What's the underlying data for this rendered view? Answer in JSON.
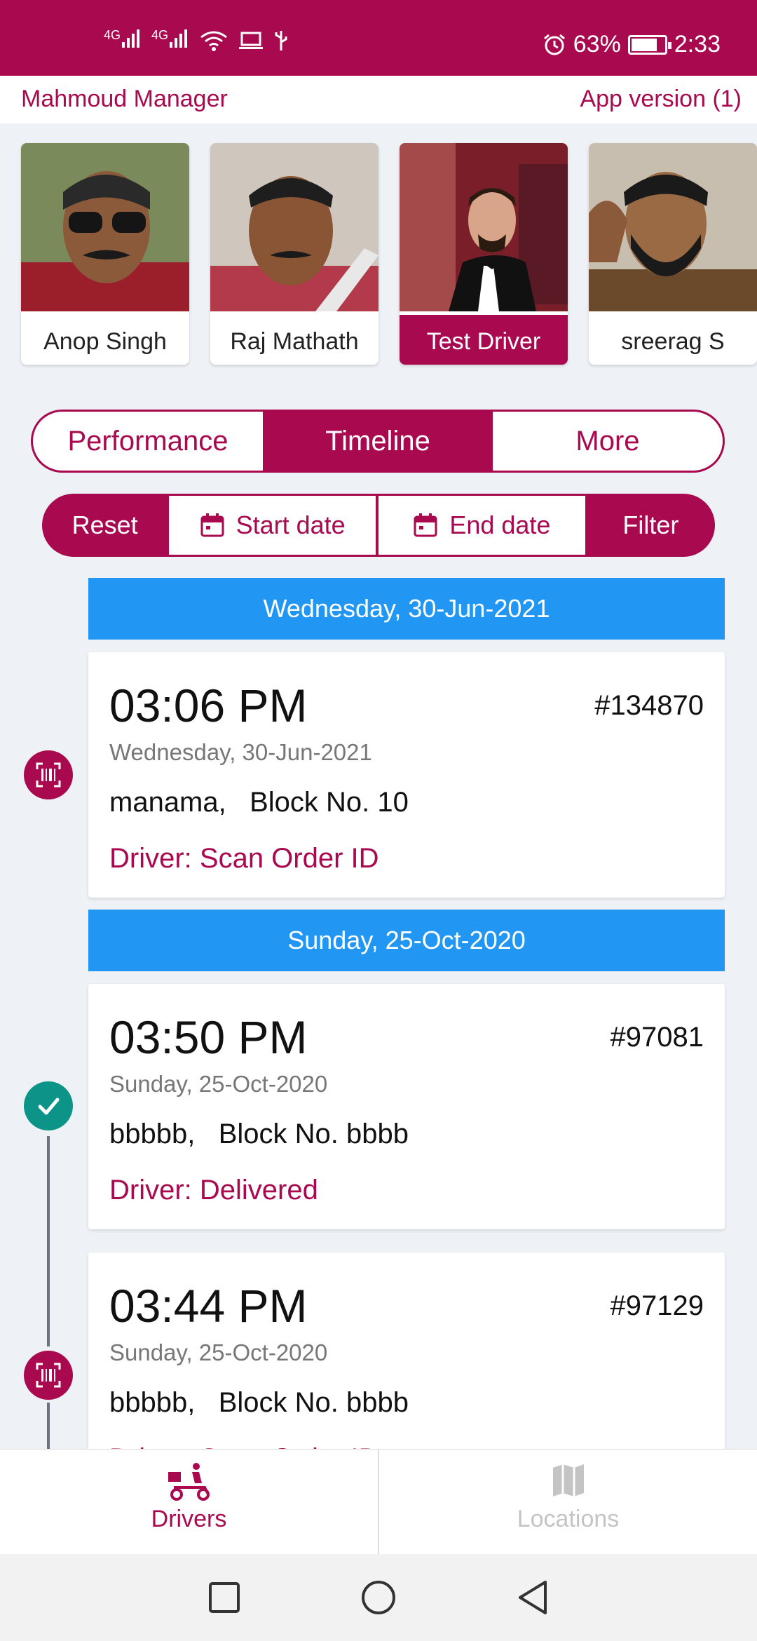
{
  "status_bar": {
    "signal1": "4G",
    "signal2": "4G",
    "battery": "63%",
    "time": "2:33"
  },
  "header": {
    "manager": "Mahmoud Manager",
    "version": "App version (1)"
  },
  "drivers": [
    {
      "name": "Anop Singh",
      "active": false
    },
    {
      "name": "Raj Mathath",
      "active": false
    },
    {
      "name": "Test Driver",
      "active": true
    },
    {
      "name": "sreerag S",
      "active": false
    }
  ],
  "tabs": {
    "performance": "Performance",
    "timeline": "Timeline",
    "more": "More",
    "selected": "Timeline"
  },
  "filters": {
    "reset": "Reset",
    "start_date": "Start date",
    "end_date": "End date",
    "filter": "Filter"
  },
  "timeline": {
    "groups": [
      {
        "date_header": "Wednesday, 30-Jun-2021"
      },
      {
        "date_header": "Sunday, 25-Oct-2020"
      }
    ],
    "entries": [
      {
        "time": "03:06 PM",
        "order": "#134870",
        "date": "Wednesday, 30-Jun-2021",
        "city": "manama,",
        "block": "Block No. 10",
        "status": "Driver: Scan Order ID",
        "icon": "barcode-scan-icon"
      },
      {
        "time": "03:50 PM",
        "order": "#97081",
        "date": "Sunday, 25-Oct-2020",
        "city": "bbbbb,",
        "block": "Block No. bbbb",
        "status": "Driver: Delivered",
        "icon": "check-icon"
      },
      {
        "time": "03:44 PM",
        "order": "#97129",
        "date": "Sunday, 25-Oct-2020",
        "city": "bbbbb,",
        "block": "Block No. bbbb",
        "status": "Driver: Scan Order ID",
        "icon": "barcode-scan-icon"
      }
    ]
  },
  "bottom_nav": {
    "drivers": "Drivers",
    "locations": "Locations",
    "selected": "Drivers"
  },
  "colors": {
    "brand": "#a8094f",
    "date_header": "#2196f3",
    "delivered": "#0d9488"
  }
}
